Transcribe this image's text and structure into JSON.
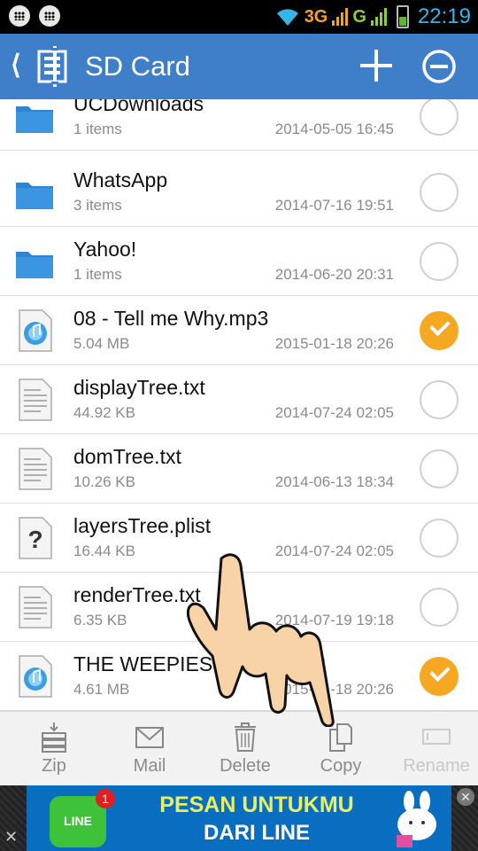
{
  "status_bar": {
    "network_3g": "3G",
    "network_g": "G",
    "time": "22:19"
  },
  "header": {
    "title": "SD Card",
    "icons": [
      "back-icon",
      "zip-app-icon",
      "add-icon",
      "remove-icon"
    ]
  },
  "files": [
    {
      "name": "UCDownloads",
      "meta": "1 items",
      "date": "2014-05-05 16:45",
      "type": "folder",
      "selected": false
    },
    {
      "name": "WhatsApp",
      "meta": "3 items",
      "date": "2014-07-16 19:51",
      "type": "folder",
      "selected": false
    },
    {
      "name": "Yahoo!",
      "meta": "1 items",
      "date": "2014-06-20 20:31",
      "type": "folder",
      "selected": false
    },
    {
      "name": "08 - Tell me Why.mp3",
      "meta": "5.04 MB",
      "date": "2015-01-18 20:26",
      "type": "audio",
      "selected": true
    },
    {
      "name": "displayTree.txt",
      "meta": "44.92 KB",
      "date": "2014-07-24 02:05",
      "type": "text",
      "selected": false
    },
    {
      "name": "domTree.txt",
      "meta": "10.26 KB",
      "date": "2014-06-13 18:34",
      "type": "text",
      "selected": false
    },
    {
      "name": "layersTree.plist",
      "meta": "16.44 KB",
      "date": "2014-07-24 02:05",
      "type": "unknown",
      "selected": false
    },
    {
      "name": "renderTree.txt",
      "meta": "6.35 KB",
      "date": "2014-07-19 19:18",
      "type": "text",
      "selected": false
    },
    {
      "name": "THE WEEPIES - ...U-1.mp3",
      "meta": "4.61 MB",
      "date": "2015-01-18 20:26",
      "type": "audio",
      "selected": true
    }
  ],
  "toolbar": {
    "zip": "Zip",
    "mail": "Mail",
    "delete": "Delete",
    "copy": "Copy",
    "rename": "Rename"
  },
  "ad": {
    "logo_text": "LINE",
    "badge": "1",
    "line1": "PESAN UNTUKMU",
    "line2": "DARI LINE",
    "close": "✕"
  },
  "colors": {
    "action_bar": "#3f7fc9",
    "selected_check": "#f7a823",
    "folder": "#3b8fd8"
  }
}
